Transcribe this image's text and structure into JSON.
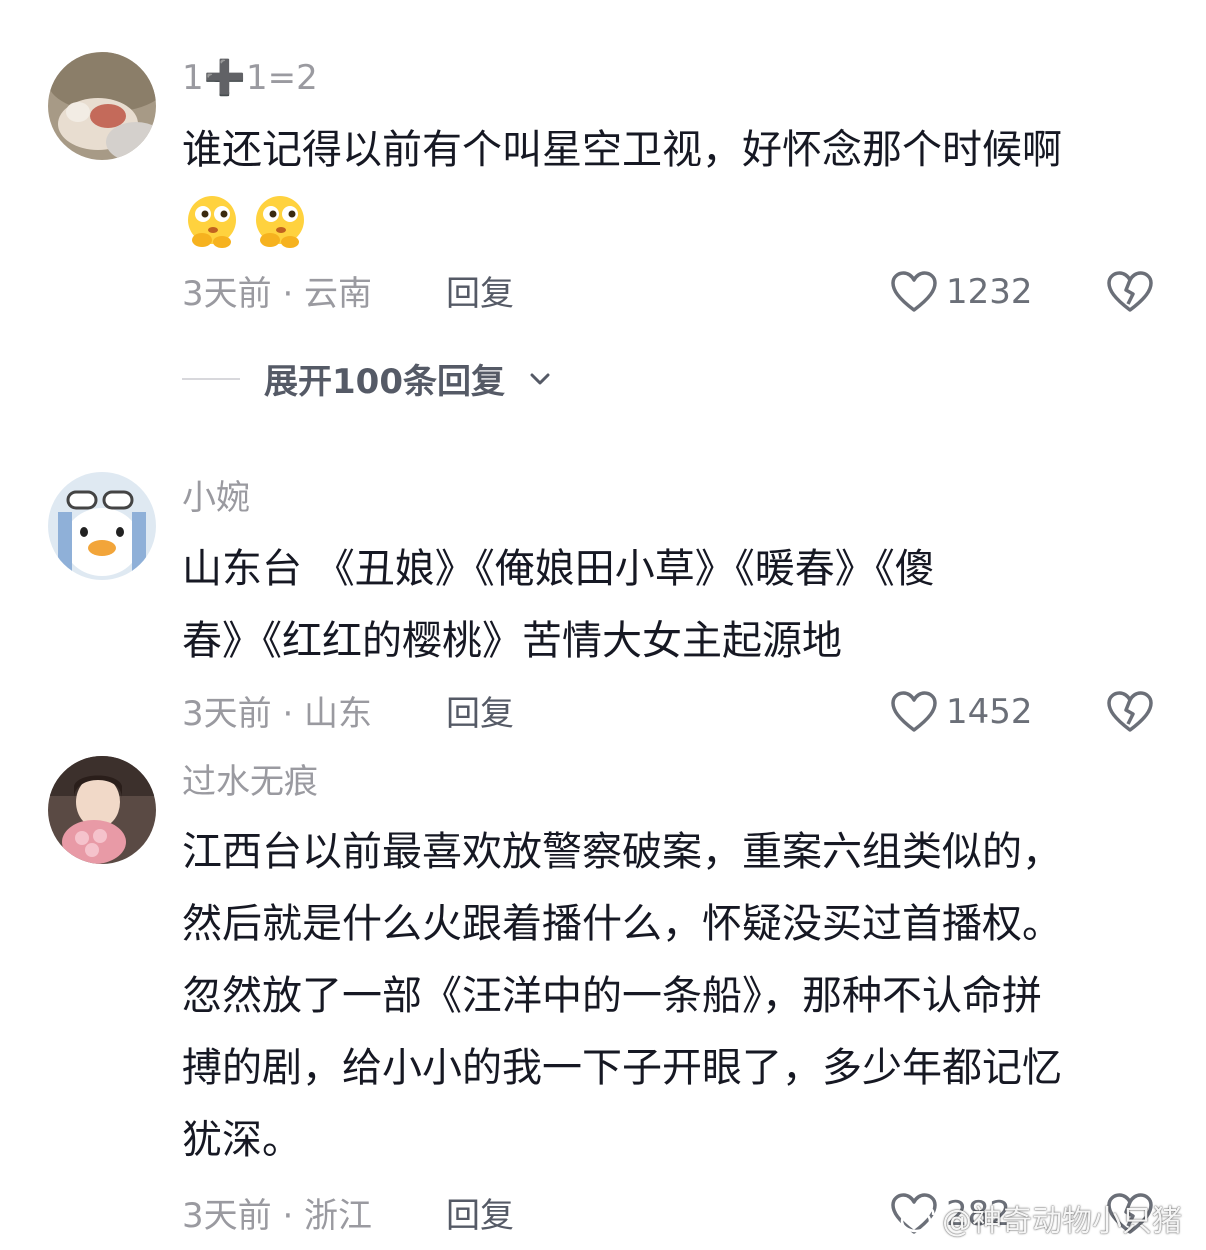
{
  "comments": [
    {
      "username_parts": [
        "1",
        "➕",
        "1=2"
      ],
      "lines": [
        "谁还记得以前有个叫星空卫视，好怀念那个时候啊"
      ],
      "emojis": [
        "thinking-face-emoji",
        "thinking-face-emoji"
      ],
      "meta": "3天前 · 云南",
      "reply_label": "回复",
      "likes": "1232",
      "expand_label": "展开100条回复"
    },
    {
      "username": "小婉",
      "lines": [
        "山东台 《丑娘》《俺娘田小草》《暖春》《傻",
        "春》《红红的樱桃》苦情大女主起源地"
      ],
      "meta": "3天前 · 山东",
      "reply_label": "回复",
      "likes": "1452"
    },
    {
      "username": "过水无痕",
      "lines": [
        "江西台以前最喜欢放警察破案，重案六组类似的，",
        "然后就是什么火跟着播什么，怀疑没买过首播权。",
        "忽然放了一部《汪洋中的一条船》，那种不认命拼",
        "搏的剧，给小小的我一下子开眼了，多少年都记忆",
        "犹深。"
      ],
      "meta": "3天前 · 浙江",
      "reply_label": "回复",
      "likes": "282"
    }
  ],
  "watermark": "@神奇动物小只猪",
  "colors": {
    "text": "#161823",
    "secondary": "#9a9aa0",
    "icon": "#6b6f78"
  }
}
